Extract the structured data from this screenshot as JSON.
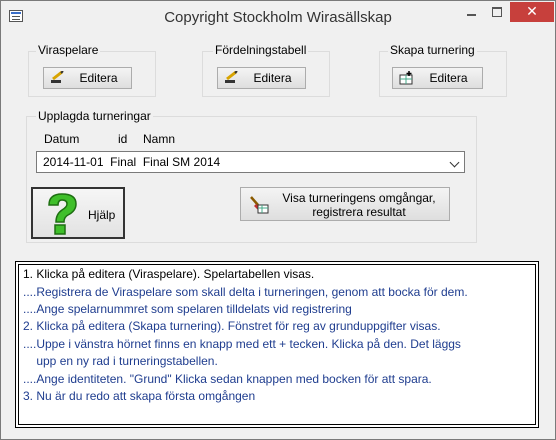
{
  "window": {
    "title": "Copyright Stockholm Wirasällskap"
  },
  "groups": {
    "viraspelare": {
      "label": "Viraspelare",
      "button": "Editera"
    },
    "fordelning": {
      "label": "Fördelningstabell",
      "button": "Editera"
    },
    "skapa": {
      "label": "Skapa turnering",
      "button": "Editera"
    }
  },
  "tournaments": {
    "label": "Upplagda turneringar",
    "columns": [
      "Datum",
      "id",
      "Namn"
    ],
    "selected": "2014-11-01  Final  Final SM 2014"
  },
  "buttons": {
    "help": "Hjälp",
    "show_line1": "Visa turneringens omgångar,",
    "show_line2": "registrera resultat"
  },
  "instructions": [
    "1. Klicka på editera (Viraspelare).  Spelartabellen visas.",
    "....Registrera de Viraspelare som skall delta i turneringen, genom att bocka för dem.",
    "....Ange spelarnummret som spelaren tilldelats vid registrering",
    "2. Klicka på editera (Skapa turnering). Fönstret för reg av grunduppgifter visas.",
    "....Uppe i vänstra hörnet finns en knapp med ett + tecken. Klicka på den. Det läggs",
    "    upp en ny rad i turneringstabellen.",
    "....Ange identiteten. \"Grund\"  Klicka sedan knappen med bocken för att spara.",
    "3. Nu är du redo att skapa första omgången"
  ],
  "colors": {
    "close_button": "#c7403c",
    "instruction_text": "#1f3d8f"
  }
}
